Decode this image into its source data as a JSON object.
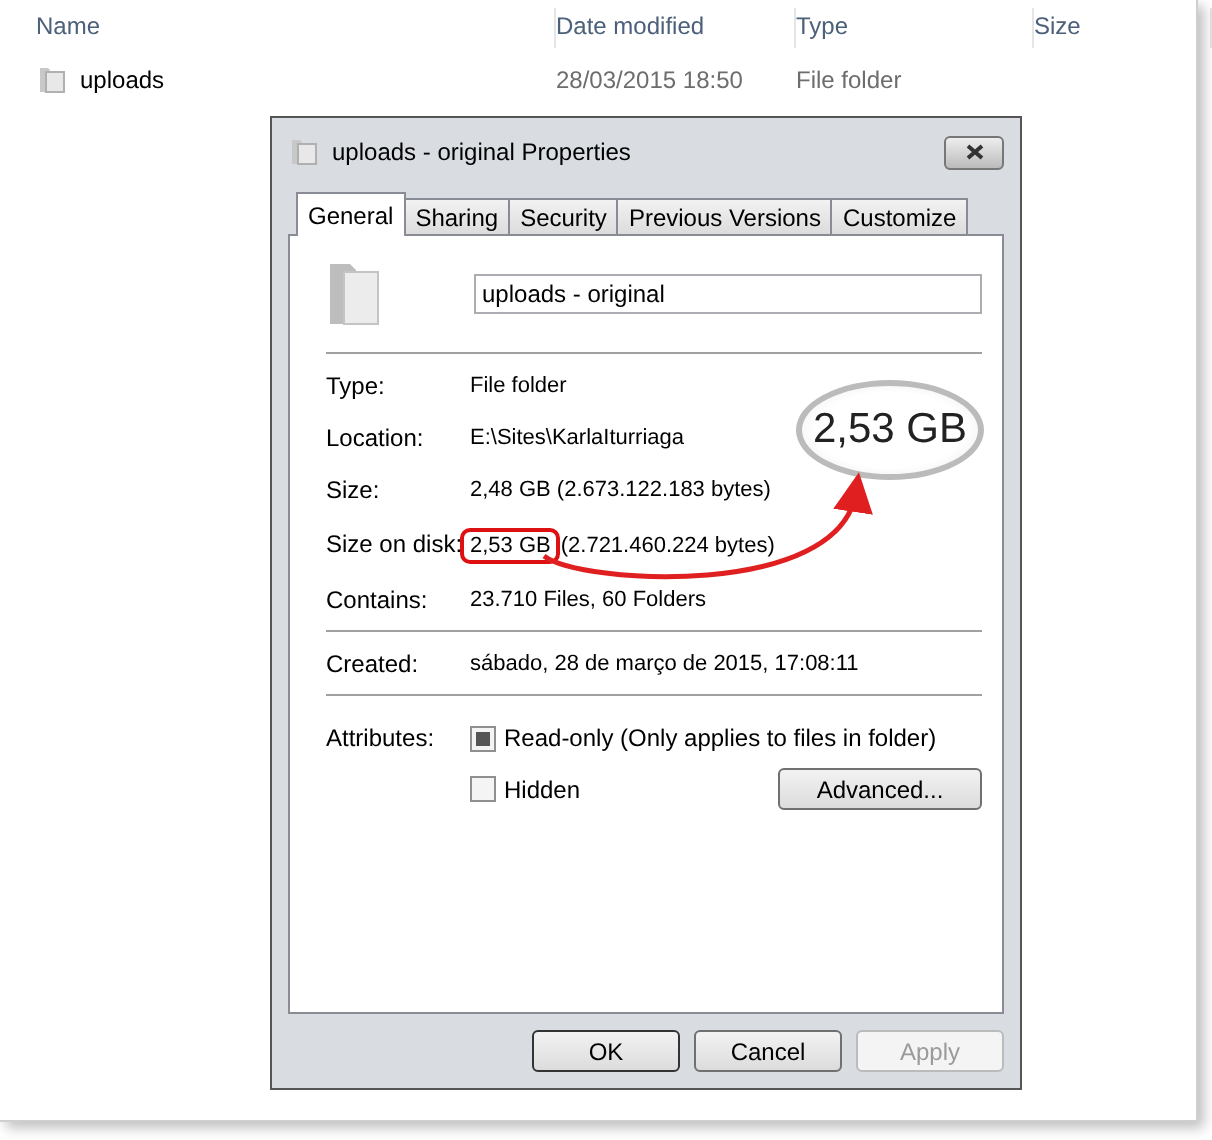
{
  "explorer": {
    "columns": [
      {
        "label": "Name"
      },
      {
        "label": "Date modified"
      },
      {
        "label": "Type"
      },
      {
        "label": "Size"
      }
    ],
    "rows": [
      {
        "name": "uploads",
        "date_modified": "28/03/2015 18:50",
        "type": "File folder"
      }
    ]
  },
  "dialog": {
    "title": "uploads - original Properties",
    "tabs": [
      {
        "label": "General",
        "selected": true
      },
      {
        "label": "Sharing",
        "selected": false
      },
      {
        "label": "Security",
        "selected": false
      },
      {
        "label": "Previous Versions",
        "selected": false
      },
      {
        "label": "Customize",
        "selected": false
      }
    ],
    "name_field": {
      "value": "uploads - original"
    },
    "property_groups": [
      [
        {
          "label": "Type:",
          "value": "File folder",
          "highlighted": false
        },
        {
          "label": "Location:",
          "value": "E:\\Sites\\KarlaIturriaga",
          "highlighted": false
        },
        {
          "label": "Size:",
          "value": "2,48 GB (2.673.122.183 bytes)",
          "highlighted": false
        },
        {
          "label": "Size on disk:",
          "value": "2,53 GB",
          "detail": "(2.721.460.224 bytes)",
          "highlighted": true
        },
        {
          "label": "Contains:",
          "value": "23.710 Files, 60 Folders",
          "highlighted": false
        }
      ],
      [
        {
          "label": "Created:",
          "value": "sábado, 28 de março de 2015, 17:08:11",
          "highlighted": false
        }
      ]
    ],
    "attributes": {
      "label": "Attributes:",
      "options": [
        {
          "label": "Read-only (Only applies to files in folder)",
          "checked": false,
          "indeterminate": true
        },
        {
          "label": "Hidden",
          "checked": false,
          "indeterminate": false
        }
      ],
      "advanced_button": "Advanced..."
    },
    "buttons": [
      {
        "label": "OK",
        "disabled": false,
        "default": true
      },
      {
        "label": "Cancel",
        "disabled": false,
        "default": false
      },
      {
        "label": "Apply",
        "disabled": true,
        "default": false
      }
    ]
  },
  "annotation": {
    "callout": "2,53 GB"
  }
}
